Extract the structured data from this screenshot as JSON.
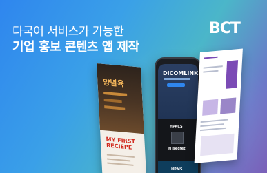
{
  "banner": {
    "headline_line1": "다국어 서비스가 가능한",
    "headline_line2": "기업 홍보 콘텐츠 앱 제작",
    "logo": "BCT"
  },
  "mockups": {
    "left_page_title": "양념육",
    "left_page_subtitle": "MY FIRST RECIEPE",
    "phone_brand": "DICOMLINK",
    "phone_section_label": "HPACS",
    "phone_section_label_2": "HTsecret",
    "phone_bottom_label": "HPMS"
  },
  "colors": {
    "gradient_start": "#2f86ee",
    "gradient_end": "#7a5fb8",
    "text": "#ffffff",
    "accent_red": "#d12a1f",
    "accent_purple": "#7b4bb5"
  }
}
